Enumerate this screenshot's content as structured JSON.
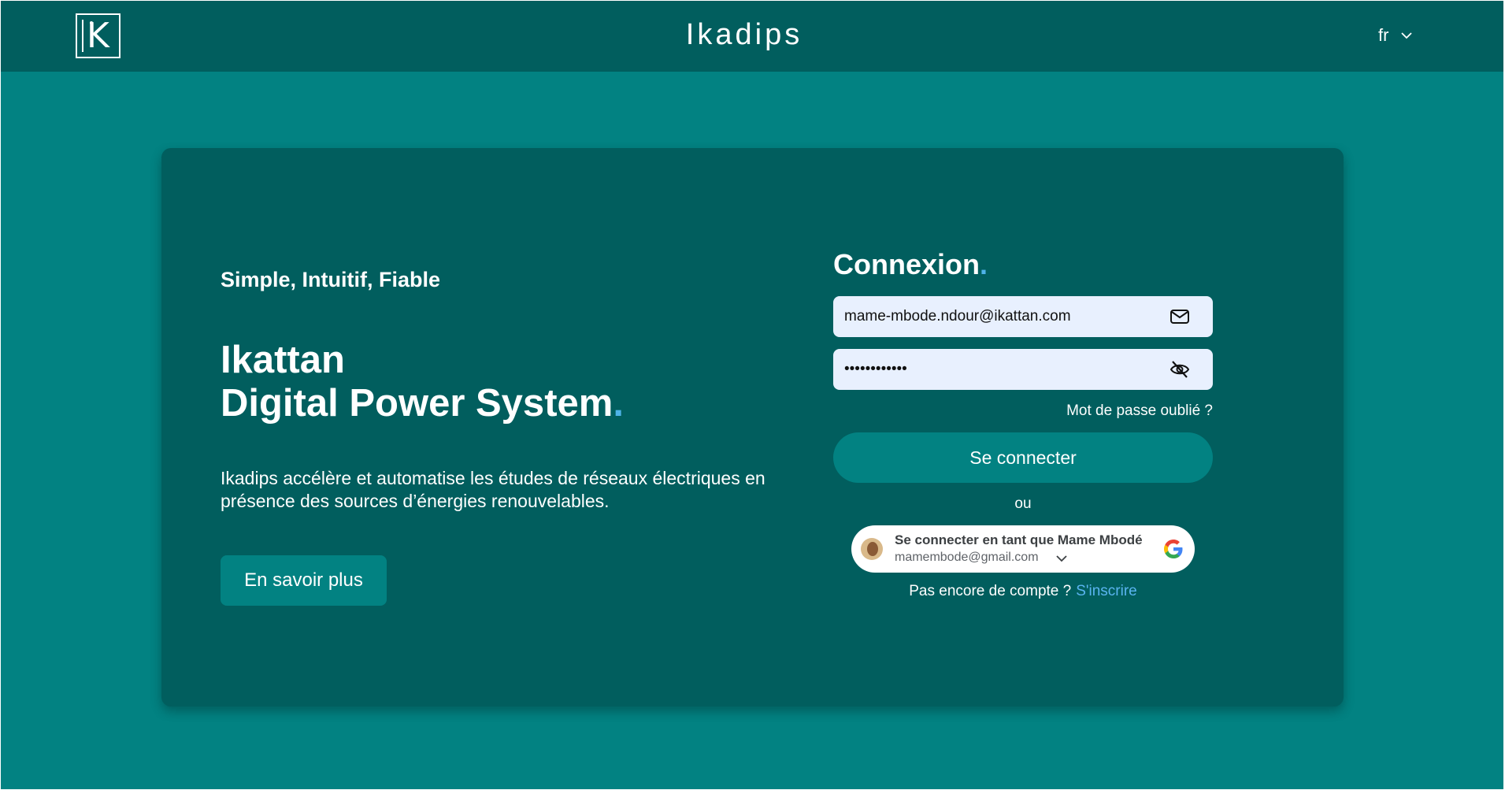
{
  "header": {
    "brand": "Ikadips",
    "language": "fr"
  },
  "hero": {
    "tagline": "Simple, Intuitif, Fiable",
    "title_line1": "Ikattan",
    "title_line2": "Digital Power System",
    "title_dot": ".",
    "description": "Ikadips accélère et automatise les études de réseaux électriques en présence des sources d’énergies renouvelables.",
    "learn_more": "En savoir plus"
  },
  "login": {
    "title": "Connexion",
    "title_dot": ".",
    "email_value": "mame-mbode.ndour@ikattan.com",
    "password_value": "mame-mbode12",
    "forgot_password": "Mot de passe oublié ?",
    "submit": "Se connecter",
    "or": "ou",
    "google": {
      "name": "Se connecter en tant que Mame Mbodé",
      "email": "mamembode@gmail.com"
    },
    "no_account": "Pas encore de compte ?",
    "signup_link": "S'inscrire"
  },
  "colors": {
    "background": "#028282",
    "header": "#015e5e",
    "card": "#015e5e",
    "accent": "#4fb3e8",
    "field": "#e8f0fe"
  },
  "icons": {
    "email_field": "mail-icon",
    "password_field": "eye-off-icon",
    "language_dropdown": "chevron-down-icon",
    "google": "google-icon"
  }
}
